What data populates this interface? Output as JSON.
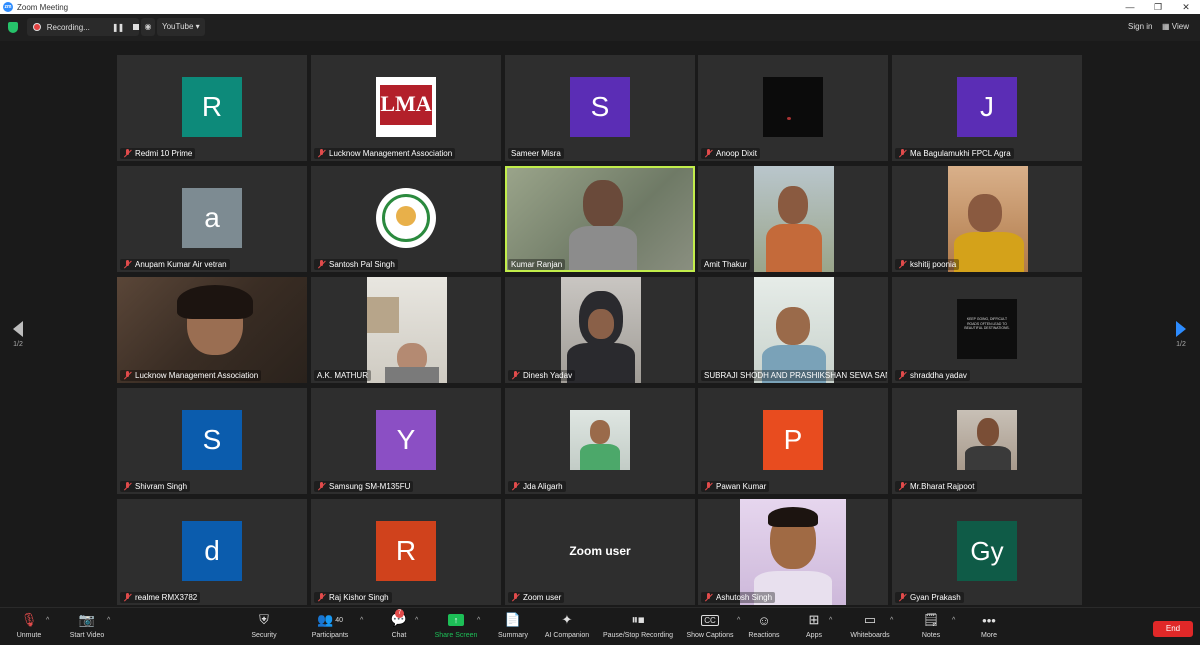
{
  "window": {
    "title": "Zoom Meeting",
    "logo": "zm"
  },
  "topbar": {
    "recording_label": "Recording...",
    "stream_label": "YouTube ▾",
    "signin_label": "Sign in",
    "view_label": "View"
  },
  "colors": {
    "active_speaker": "#c2ee4b",
    "share": "#1dbf57",
    "end": "#e02828",
    "accent": "#2d8cff"
  },
  "gallery": {
    "page_left": "1/2",
    "page_right": "1/2",
    "tiles": [
      {
        "name": "Redmi 10 Prime",
        "initial": "R",
        "color": "#0d8a7a"
      },
      {
        "name": "Lucknow Management Association",
        "logo": "LMA"
      },
      {
        "name": "Sameer Misra",
        "initial": "S",
        "color": "#5b2db5"
      },
      {
        "name": "Anoop Dixit"
      },
      {
        "name": "Ma Bagulamukhi FPCL Agra",
        "initial": "J",
        "color": "#5b2db5"
      },
      {
        "name": "Anupam Kumar Air vetran",
        "initial": "a",
        "color": "#7d8b92"
      },
      {
        "name": "Santosh Pal Singh",
        "logo": "FPCL"
      },
      {
        "name": "Kumar Ranjan"
      },
      {
        "name": "Amit Thakur"
      },
      {
        "name": "kshitij poonia"
      },
      {
        "name": "Lucknow Management Association"
      },
      {
        "name": "A.K. MATHUR"
      },
      {
        "name": "Dinesh Yadav"
      },
      {
        "name": "SUBRAJI SHODH AND PRASHIKSHAN SEWA SANS..."
      },
      {
        "name": "shraddha yadav",
        "poster": "KEEP GOING, DIFFICULT ROADS OFTEN LEAD TO BEAUTIFUL DESTINATIONS."
      },
      {
        "name": "Shivram Singh",
        "initial": "S",
        "color": "#0b5cad"
      },
      {
        "name": "Samsung SM-M135FU",
        "initial": "Y",
        "color": "#8b4fc4"
      },
      {
        "name": "Jda Aligarh"
      },
      {
        "name": "Pawan Kumar",
        "initial": "P",
        "color": "#e84c1f"
      },
      {
        "name": "Mr.Bharat Rajpoot"
      },
      {
        "name": "realme RMX3782",
        "initial": "d",
        "color": "#0b5cad"
      },
      {
        "name": "Raj Kishor Singh",
        "initial": "R",
        "color": "#d0421c"
      },
      {
        "name": "Zoom user",
        "center_label": "Zoom user"
      },
      {
        "name": "Ashutosh Singh"
      },
      {
        "name": "Gyan Prakash",
        "initial": "Gy",
        "color": "#0f5b47"
      }
    ]
  },
  "toolbar": {
    "unmute": "Unmute",
    "start_video": "Start Video",
    "security": "Security",
    "participants": "Participants",
    "participants_count": "40",
    "chat": "Chat",
    "chat_badge": "7",
    "share_screen": "Share Screen",
    "summary": "Summary",
    "ai_companion": "AI Companion",
    "pause_stop_recording": "Pause/Stop Recording",
    "show_captions": "Show Captions",
    "reactions": "Reactions",
    "apps": "Apps",
    "whiteboards": "Whiteboards",
    "notes": "Notes",
    "more": "More",
    "end": "End"
  }
}
